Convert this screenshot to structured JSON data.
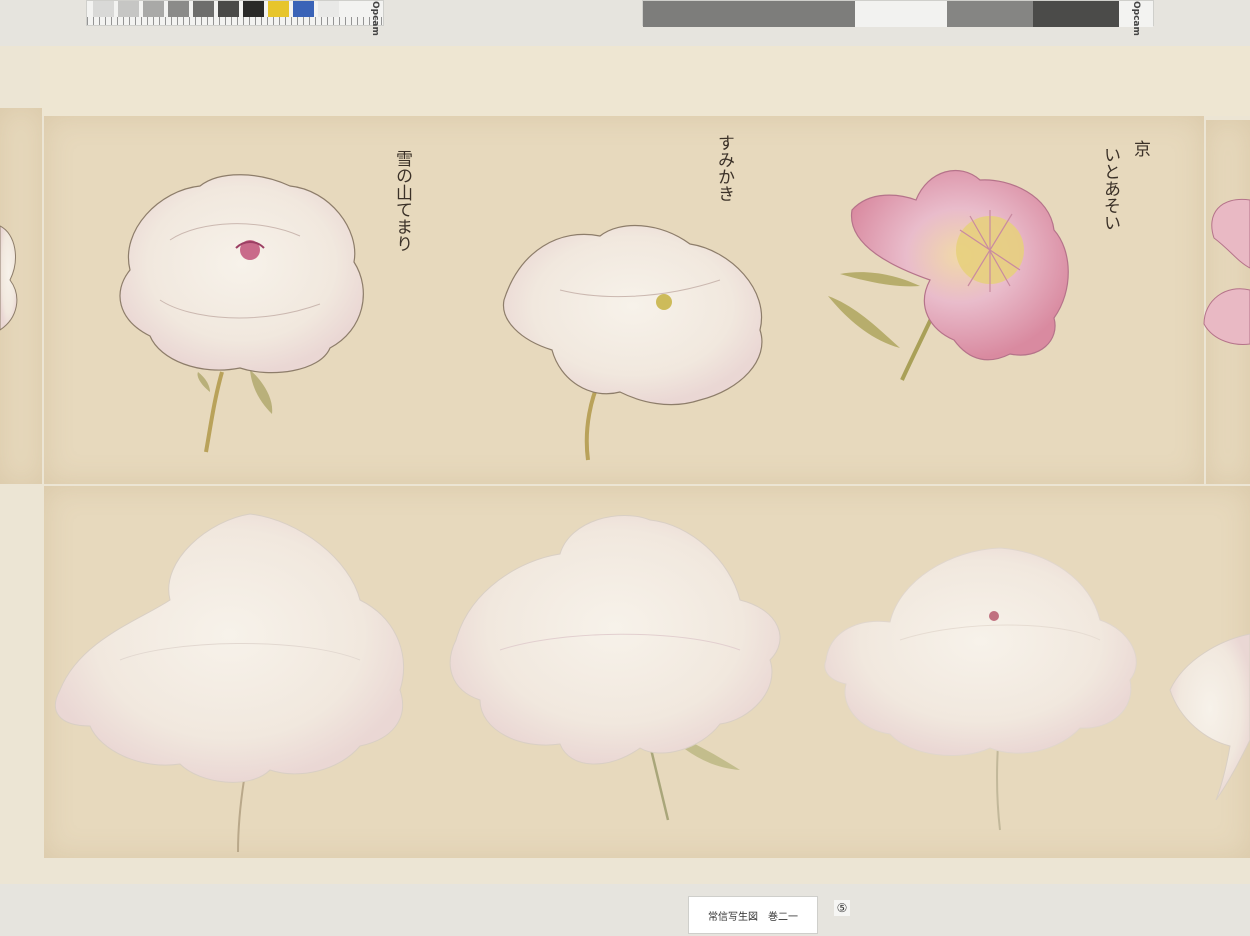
{
  "card_left": {
    "brand": "Opcam",
    "swatch_colors": [
      "#d9d9d7",
      "#c6c6c4",
      "#a9a9a7",
      "#8b8b89",
      "#6e6e6c",
      "#4a4a48",
      "#2a2a28",
      "#e7c52b",
      "#3a63b7",
      "#e9e9e7"
    ]
  },
  "card_right": {
    "brand": "Opcam",
    "gray_colors": [
      "#7d7d7b",
      "#f2f2f0",
      "#858583",
      "#4b4b49"
    ]
  },
  "inscriptions": {
    "flower1": "雪の山てまり",
    "flower2": "すみかき",
    "flower3_line1": "京",
    "flower3_line2": "いとあそい"
  },
  "label": {
    "title": "常信写生図　巻二一",
    "number": "⑤"
  },
  "palette": {
    "paper": "#e7d9bd",
    "petal_white": "#f4eee6",
    "petal_pink": "#e9b9c4",
    "petal_deep_pink": "#d98aa0",
    "stamen_yellow": "#e3cf6a",
    "leaf_green": "#b9b07a"
  }
}
